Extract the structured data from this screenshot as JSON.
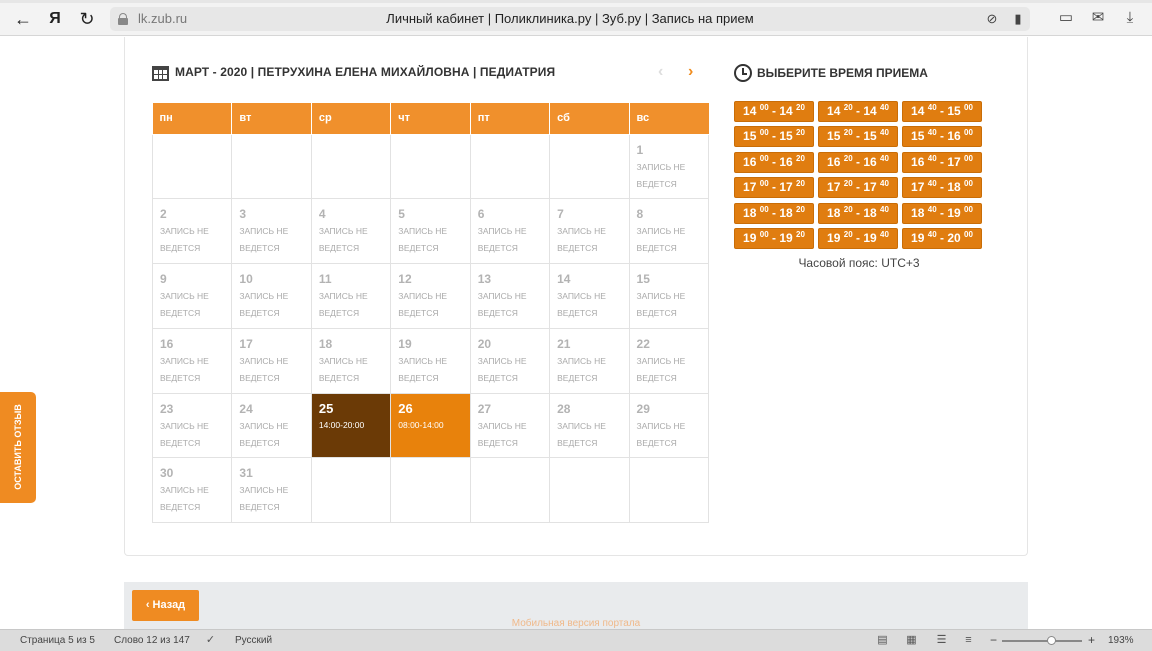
{
  "browser": {
    "host": "lk.zub.ru",
    "title": "Личный кабинет | Поликлиника.ру | Зуб.ру | Запись на прием",
    "yandex_label": "Я"
  },
  "calendar": {
    "title": "МАРТ - 2020 | ПЕТРУХИНА ЕЛЕНА МИХАЙЛОВНА | ПЕДИАТРИЯ",
    "weekdays": [
      "пн",
      "вт",
      "ср",
      "чт",
      "пт",
      "сб",
      "вс"
    ],
    "closed_note_line1": "ЗАПИСЬ НЕ",
    "closed_note_line2": "ВЕДЕТСЯ",
    "weeks": [
      [
        null,
        null,
        null,
        null,
        null,
        null,
        {
          "day": "1"
        }
      ],
      [
        {
          "day": "2"
        },
        {
          "day": "3"
        },
        {
          "day": "4"
        },
        {
          "day": "5"
        },
        {
          "day": "6"
        },
        {
          "day": "7"
        },
        {
          "day": "8"
        }
      ],
      [
        {
          "day": "9"
        },
        {
          "day": "10"
        },
        {
          "day": "11"
        },
        {
          "day": "12"
        },
        {
          "day": "13"
        },
        {
          "day": "14"
        },
        {
          "day": "15"
        }
      ],
      [
        {
          "day": "16"
        },
        {
          "day": "17"
        },
        {
          "day": "18"
        },
        {
          "day": "19"
        },
        {
          "day": "20"
        },
        {
          "day": "21"
        },
        {
          "day": "22"
        }
      ],
      [
        {
          "day": "23"
        },
        {
          "day": "24"
        },
        {
          "day": "25",
          "hours": "14:00-20:00",
          "state": "selected"
        },
        {
          "day": "26",
          "hours": "08:00-14:00",
          "state": "available"
        },
        {
          "day": "27"
        },
        {
          "day": "28"
        },
        {
          "day": "29"
        }
      ],
      [
        {
          "day": "30"
        },
        {
          "day": "31"
        },
        null,
        null,
        null,
        null,
        null
      ]
    ]
  },
  "time_picker": {
    "title": "ВЫБЕРИТЕ ВРЕМЯ ПРИЕМА",
    "slots": [
      {
        "h1": "14",
        "m1": "00",
        "h2": "14",
        "m2": "20"
      },
      {
        "h1": "14",
        "m1": "20",
        "h2": "14",
        "m2": "40"
      },
      {
        "h1": "14",
        "m1": "40",
        "h2": "15",
        "m2": "00"
      },
      {
        "h1": "15",
        "m1": "00",
        "h2": "15",
        "m2": "20"
      },
      {
        "h1": "15",
        "m1": "20",
        "h2": "15",
        "m2": "40"
      },
      {
        "h1": "15",
        "m1": "40",
        "h2": "16",
        "m2": "00"
      },
      {
        "h1": "16",
        "m1": "00",
        "h2": "16",
        "m2": "20"
      },
      {
        "h1": "16",
        "m1": "20",
        "h2": "16",
        "m2": "40"
      },
      {
        "h1": "16",
        "m1": "40",
        "h2": "17",
        "m2": "00"
      },
      {
        "h1": "17",
        "m1": "00",
        "h2": "17",
        "m2": "20"
      },
      {
        "h1": "17",
        "m1": "20",
        "h2": "17",
        "m2": "40"
      },
      {
        "h1": "17",
        "m1": "40",
        "h2": "18",
        "m2": "00"
      },
      {
        "h1": "18",
        "m1": "00",
        "h2": "18",
        "m2": "20"
      },
      {
        "h1": "18",
        "m1": "20",
        "h2": "18",
        "m2": "40"
      },
      {
        "h1": "18",
        "m1": "40",
        "h2": "19",
        "m2": "00"
      },
      {
        "h1": "19",
        "m1": "00",
        "h2": "19",
        "m2": "20"
      },
      {
        "h1": "19",
        "m1": "20",
        "h2": "19",
        "m2": "40"
      },
      {
        "h1": "19",
        "m1": "40",
        "h2": "20",
        "m2": "00"
      }
    ],
    "timezone": "Часовой пояс: UTC+3"
  },
  "footer": {
    "back_label": "Назад",
    "mobile_link": "Мобильная версия портала"
  },
  "feedback_tab": "ОСТАВИТЬ ОТЗЫВ",
  "status_bar": {
    "page": "Страница 5 из 5",
    "word": "Слово 12 из 147",
    "language": "Русский",
    "zoom": "193%",
    "zoom_minus": "−",
    "zoom_plus": "+"
  },
  "colors": {
    "accent": "#f0902c",
    "selected_day": "#6b3a06",
    "available_day": "#e8820c",
    "slot": "#e07d10"
  }
}
